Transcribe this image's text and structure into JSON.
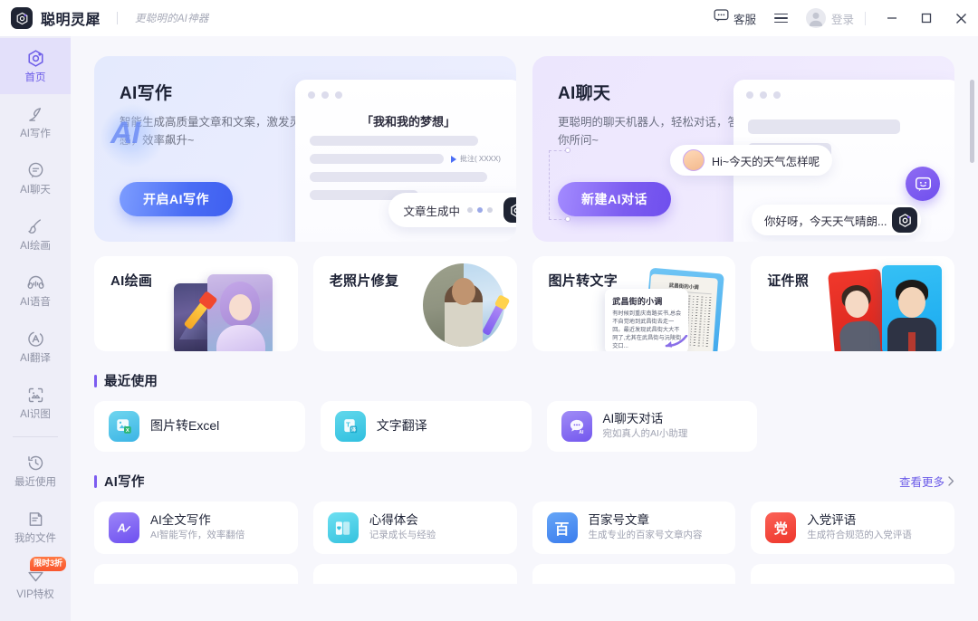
{
  "titlebar": {
    "brand_name": "聪明灵犀",
    "tagline": "更聪明的AI神器",
    "support_label": "客服",
    "login_label": "登录",
    "minimize": "—",
    "maximize": "□",
    "close": "✕"
  },
  "sidebar": {
    "items": [
      {
        "label": "首页",
        "icon": "home-hex-icon",
        "active": true
      },
      {
        "label": "AI写作",
        "icon": "pen-icon",
        "active": false
      },
      {
        "label": "AI聊天",
        "icon": "chat-bubble-icon",
        "active": false
      },
      {
        "label": "AI绘画",
        "icon": "brush-icon",
        "active": false
      },
      {
        "label": "AI语音",
        "icon": "headphone-icon",
        "active": false
      },
      {
        "label": "AI翻译",
        "icon": "translate-circle-icon",
        "active": false
      },
      {
        "label": "AI识图",
        "icon": "image-scan-icon",
        "active": false
      }
    ],
    "items2": [
      {
        "label": "最近使用",
        "icon": "history-clock-icon",
        "active": false
      },
      {
        "label": "我的文件",
        "icon": "document-icon",
        "active": false
      },
      {
        "label": "VIP特权",
        "icon": "diamond-icon",
        "active": false,
        "badge": "限时3折"
      }
    ]
  },
  "hero": {
    "writing": {
      "title": "AI写作",
      "subtitle": "智能生成高质量文章和文案，激发灵感，效率飙升~",
      "button": "开启AI写作",
      "mock_title": "「我和我的梦想」",
      "mock_anno": "批注( XXXX)",
      "mock_status": "文章生成中",
      "watermark": "AI"
    },
    "chat": {
      "title": "AI聊天",
      "subtitle": "更聪明的聊天机器人，轻松对话，答你所问~",
      "button": "新建AI对话",
      "bubble_user": "Hi~今天的天气怎样呢",
      "bubble_ai": "你好呀，今天天气晴朗..."
    }
  },
  "features": [
    {
      "title": "AI绘画",
      "art": "ai-painting"
    },
    {
      "title": "老照片修复",
      "art": "photo-restore"
    },
    {
      "title": "图片转文字",
      "art": "image-to-text",
      "ocr_title": "武昌街的小调",
      "ocr_body": "有时候到重庆南路买书,总会不自觉地到武昌街去走一回。最近发现武昌街大大不同了,尤其在武昌街与沅陵街交口..."
    },
    {
      "title": "证件照",
      "art": "id-photo"
    }
  ],
  "recent": {
    "section_title": "最近使用",
    "items": [
      {
        "name": "图片转Excel",
        "desc": "",
        "icon": "image-excel-icon",
        "color": "#4fc4e8"
      },
      {
        "name": "文字翻译",
        "desc": "",
        "icon": "translate-doc-icon",
        "color": "#45c8e0"
      },
      {
        "name": "AI聊天对话",
        "desc": "宛如真人的AI小助理",
        "icon": "ai-chat-icon",
        "color": "#7c5cf0"
      }
    ]
  },
  "writing_section": {
    "section_title": "AI写作",
    "more_label": "查看更多",
    "items": [
      {
        "name": "AI全文写作",
        "desc": "AI智能写作，效率翻倍",
        "icon": "ai-pen-icon",
        "color": "#7b63f2",
        "glyph": "A"
      },
      {
        "name": "心得体会",
        "desc": "记录成长与经验",
        "icon": "book-heart-icon",
        "color": "#4fd0e8",
        "glyph": ""
      },
      {
        "name": "百家号文章",
        "desc": "生成专业的百家号文章内容",
        "icon": "baijiahao-icon",
        "color": "#4a8ff0",
        "glyph": "百"
      },
      {
        "name": "入党评语",
        "desc": "生成符合规范的入党评语",
        "icon": "party-icon",
        "color": "#f0453a",
        "glyph": "党"
      }
    ]
  },
  "colors": {
    "accent_purple": "#6c5ce8",
    "accent_blue": "#4a6df5",
    "badge_orange": "#f9562f",
    "page_bg": "#f7f7fc",
    "sidebar_bg": "#eeeef8"
  }
}
